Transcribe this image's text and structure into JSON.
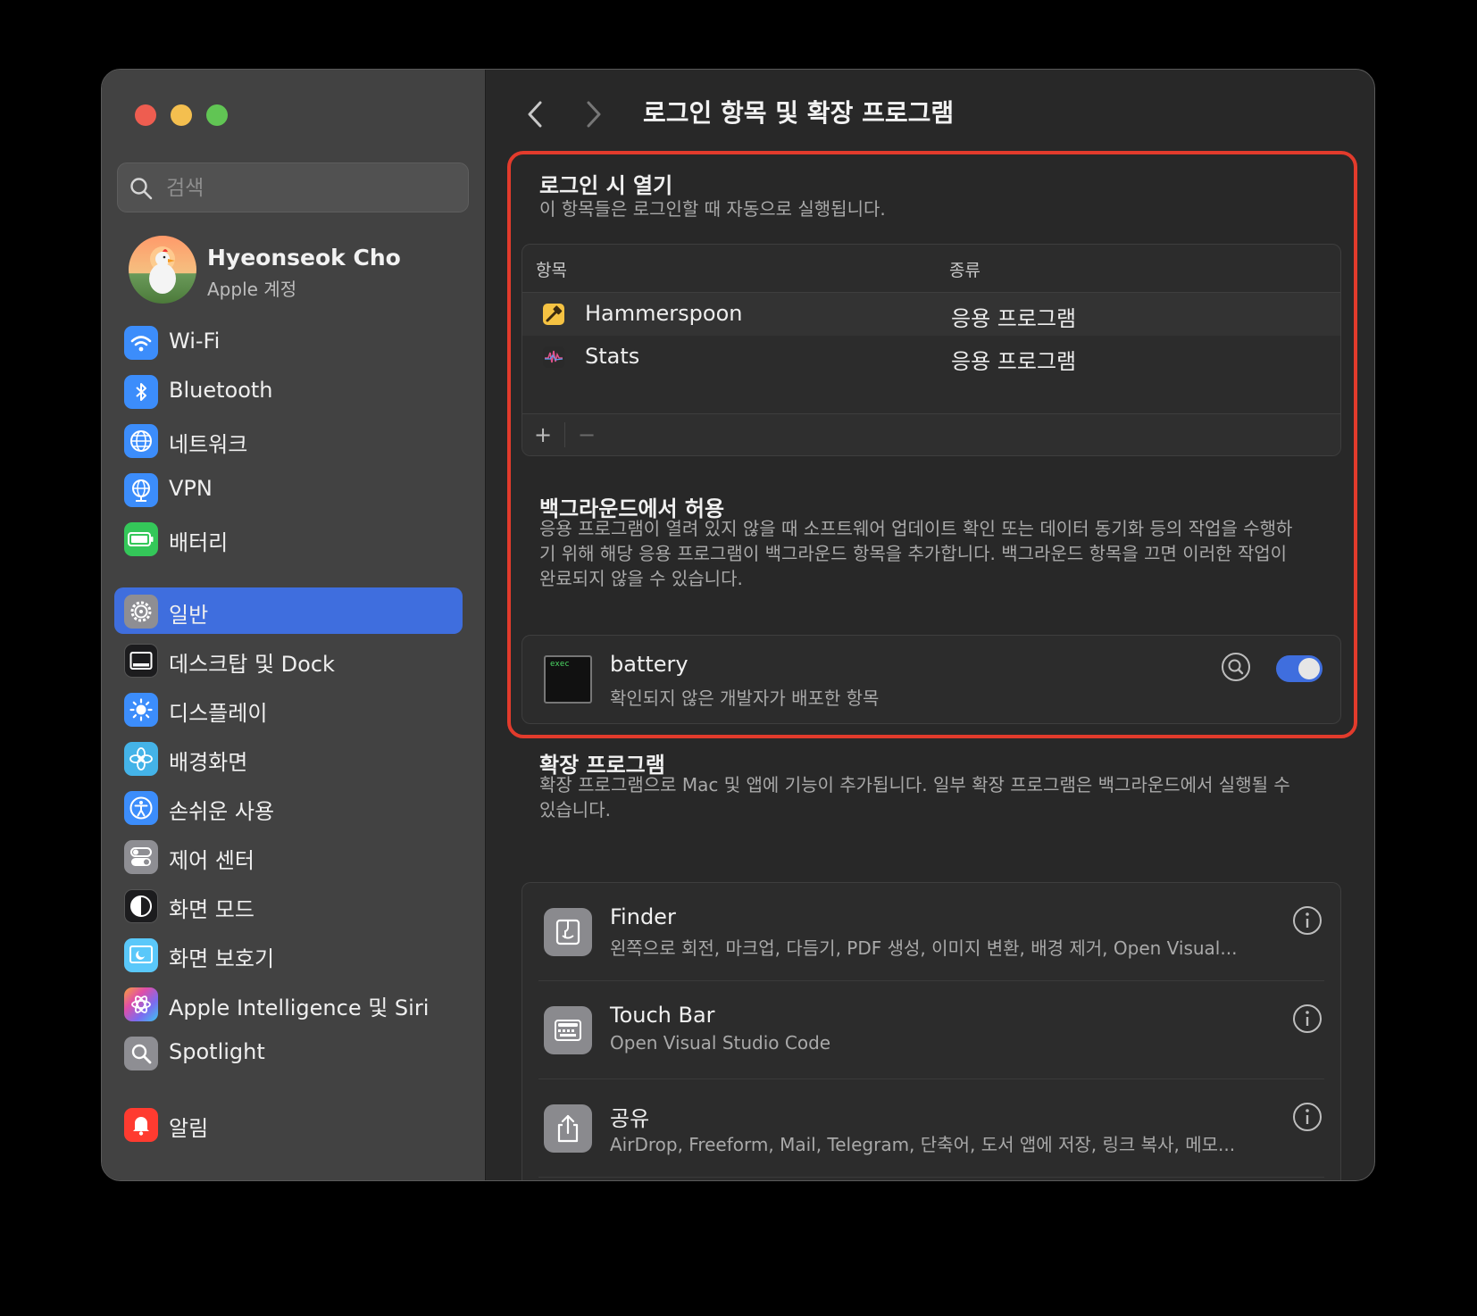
{
  "window": {
    "traffic_lights": {
      "close": "#ee5d50",
      "minimize": "#f4bf4f",
      "zoom": "#61c554"
    }
  },
  "sidebar": {
    "search": {
      "placeholder": "검색"
    },
    "profile": {
      "name": "Hyeonseok Cho",
      "subtitle": "Apple 계정"
    },
    "items": [
      {
        "label": "Wi-Fi",
        "icon": "wifi-icon",
        "color": "#3c8dfb"
      },
      {
        "label": "Bluetooth",
        "icon": "bluetooth-icon",
        "color": "#3c8dfb"
      },
      {
        "label": "네트워크",
        "icon": "globe-icon",
        "color": "#3c8dfb"
      },
      {
        "label": "VPN",
        "icon": "vpn-globe-icon",
        "color": "#3c8dfb"
      },
      {
        "label": "배터리",
        "icon": "battery-icon",
        "color": "#34c759"
      },
      {
        "label": "일반",
        "icon": "gear-icon",
        "color": "#8e8e93",
        "active": true
      },
      {
        "label": "데스크탑 및 Dock",
        "icon": "dock-icon",
        "color": "#1c1c1e"
      },
      {
        "label": "디스플레이",
        "icon": "sun-icon",
        "color": "#3c8dfb"
      },
      {
        "label": "배경화면",
        "icon": "flower-icon",
        "color": "#44b3e8"
      },
      {
        "label": "손쉬운 사용",
        "icon": "accessibility-icon",
        "color": "#3c8dfb"
      },
      {
        "label": "제어 센터",
        "icon": "switches-icon",
        "color": "#8e8e93"
      },
      {
        "label": "화면 모드",
        "icon": "appearance-icon",
        "color": "#1c1c1e"
      },
      {
        "label": "화면 보호기",
        "icon": "screensaver-icon",
        "color": "#5ac8fa"
      },
      {
        "label": "Apple Intelligence 및 Siri",
        "icon": "siri-icon",
        "color": "#c86dd7"
      },
      {
        "label": "Spotlight",
        "icon": "magnifier-icon",
        "color": "#8e8e93"
      },
      {
        "label": "알림",
        "icon": "bell-icon",
        "color": "#ff3b30"
      }
    ]
  },
  "main": {
    "title": "로그인 항목 및 확장 프로그램",
    "login": {
      "title": "로그인 시 열기",
      "description": "이 항목들은 로그인할 때 자동으로 실행됩니다.",
      "columns": {
        "item": "항목",
        "kind": "종류"
      },
      "rows": [
        {
          "name": "Hammerspoon",
          "kind": "응용 프로그램",
          "icon": "hammerspoon-icon"
        },
        {
          "name": "Stats",
          "kind": "응용 프로그램",
          "icon": "stats-icon"
        }
      ],
      "add_label": "+",
      "remove_label": "−"
    },
    "background": {
      "title": "백그라운드에서 허용",
      "description": "응용 프로그램이 열려 있지 않을 때 소프트웨어 업데이트 확인 또는 데이터 동기화 등의 작업을 수행하기 위해 해당 응용 프로그램이 백그라운드 항목을 추가합니다. 백그라운드 항목을 끄면 이러한 작업이 완료되지 않을 수 있습니다.",
      "item": {
        "name": "battery",
        "subtitle": "확인되지 않은 개발자가 배포한 항목",
        "icon_text": "exec",
        "enabled": true
      }
    },
    "extensions": {
      "title": "확장 프로그램",
      "description": "확장 프로그램으로 Mac 및 앱에 기능이 추가됩니다. 일부 확장 프로그램은 백그라운드에서 실행될 수 있습니다.",
      "items": [
        {
          "name": "Finder",
          "subtitle": "왼쪽으로 회전, 마크업, 다듬기, PDF 생성, 이미지 변환, 배경 제거, Open Visual...",
          "icon": "finder-icon"
        },
        {
          "name": "Touch Bar",
          "subtitle": "Open Visual Studio Code",
          "icon": "touchbar-icon"
        },
        {
          "name": "공유",
          "subtitle": "AirDrop, Freeform, Mail, Telegram, 단축어, 도서 앱에 저장, 링크 복사, 메모...",
          "icon": "share-icon"
        }
      ]
    }
  },
  "accent_color": "#3f6ede",
  "highlight_color": "#e23b2c"
}
